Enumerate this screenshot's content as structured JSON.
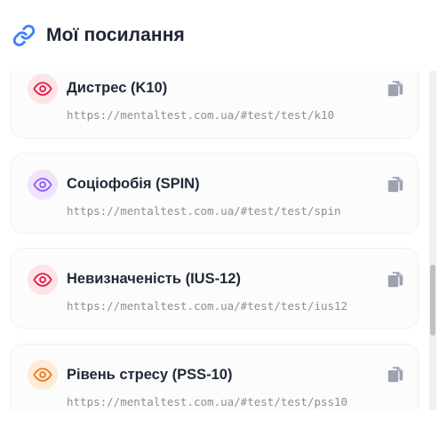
{
  "header": {
    "title": "Мої посилання",
    "icon": "link-icon",
    "help_icon": "question-circle-icon"
  },
  "colors": {
    "accent": "#3b82f6",
    "card_bg": "#fcfcfd",
    "card_border": "#eef0f3"
  },
  "links": [
    {
      "name": "Дистрес (K10)",
      "url": "https://mentaltest.com.ua/#test/test/k10",
      "eye_color": "#e11d48",
      "eye_bg": "#fde4e6"
    },
    {
      "name": "Соціофобія (SPIN)",
      "url": "https://mentaltest.com.ua/#test/test/spin",
      "eye_color": "#8b5cf6",
      "eye_bg": "#f0e4fd"
    },
    {
      "name": "Невизначеність (IUS-12)",
      "url": "https://mentaltest.com.ua/#test/test/ius12",
      "eye_color": "#e11d48",
      "eye_bg": "#fde4e6"
    },
    {
      "name": "Рівень стресу (PSS-10)",
      "url": "https://mentaltest.com.ua/#test/test/pss10",
      "eye_color": "#ea7a1c",
      "eye_bg": "#fdebd8"
    }
  ]
}
